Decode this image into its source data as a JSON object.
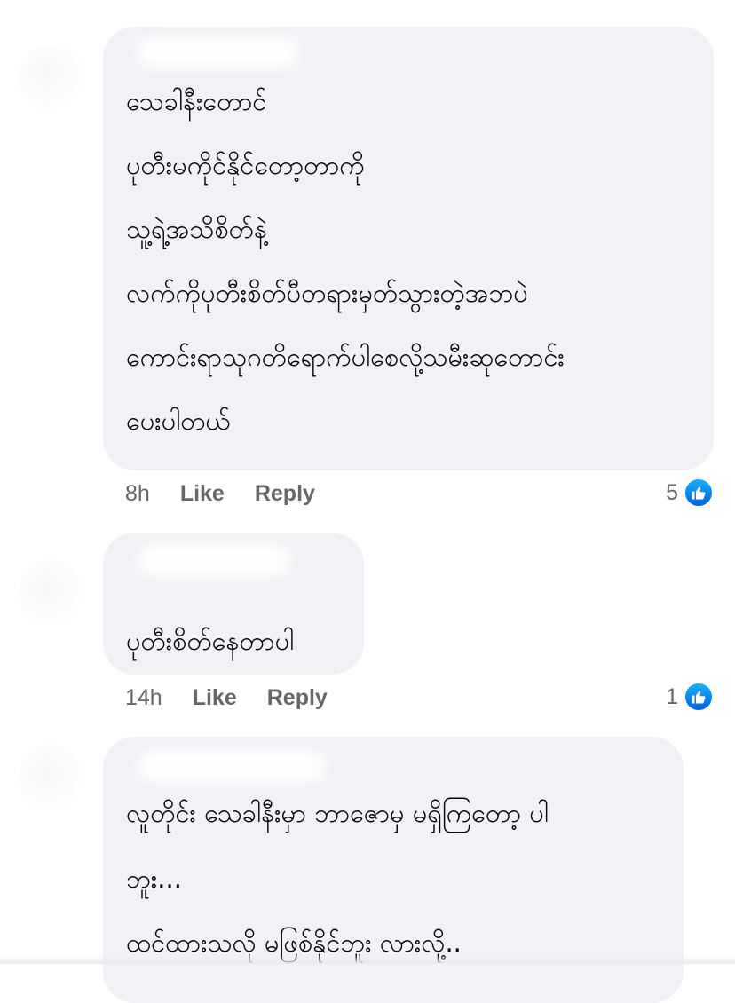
{
  "comments": [
    {
      "lines": [
        "သေခါနီးတောင်",
        "ပုတီးမကိုင်နိုင်တော့တာကို",
        "သူ့ရဲ့အသိစိတ်နဲ့",
        "လက်ကိုပုတီးစိတ်ပီတရားမှတ်သွားတဲ့အဘပဲ",
        "ကောင်းရာသုဂတိရောက်ပါစေလို့သမီးဆုတောင်း",
        "ပေးပါတယ်"
      ],
      "time": "8h",
      "like_label": "Like",
      "reply_label": "Reply",
      "reactions": "5",
      "reaction_icon": "thumbs-up-icon"
    },
    {
      "lines": [
        "ပုတီးစိတ်နေတာပါ"
      ],
      "time": "14h",
      "like_label": "Like",
      "reply_label": "Reply",
      "reactions": "1",
      "reaction_icon": "thumbs-up-icon"
    },
    {
      "lines": [
        "လူတိုင်း သေခါနီးမှာ ဘာဇောမှ မရှိကြတော့ ပါ",
        "ဘူး...",
        "ထင်ထားသလို မဖြစ်နိုင်ဘူး လားလို့.."
      ]
    }
  ],
  "colors": {
    "bubble": "#f0f2f5",
    "meta_text": "#65676b",
    "like_blue": "#1877f2"
  }
}
